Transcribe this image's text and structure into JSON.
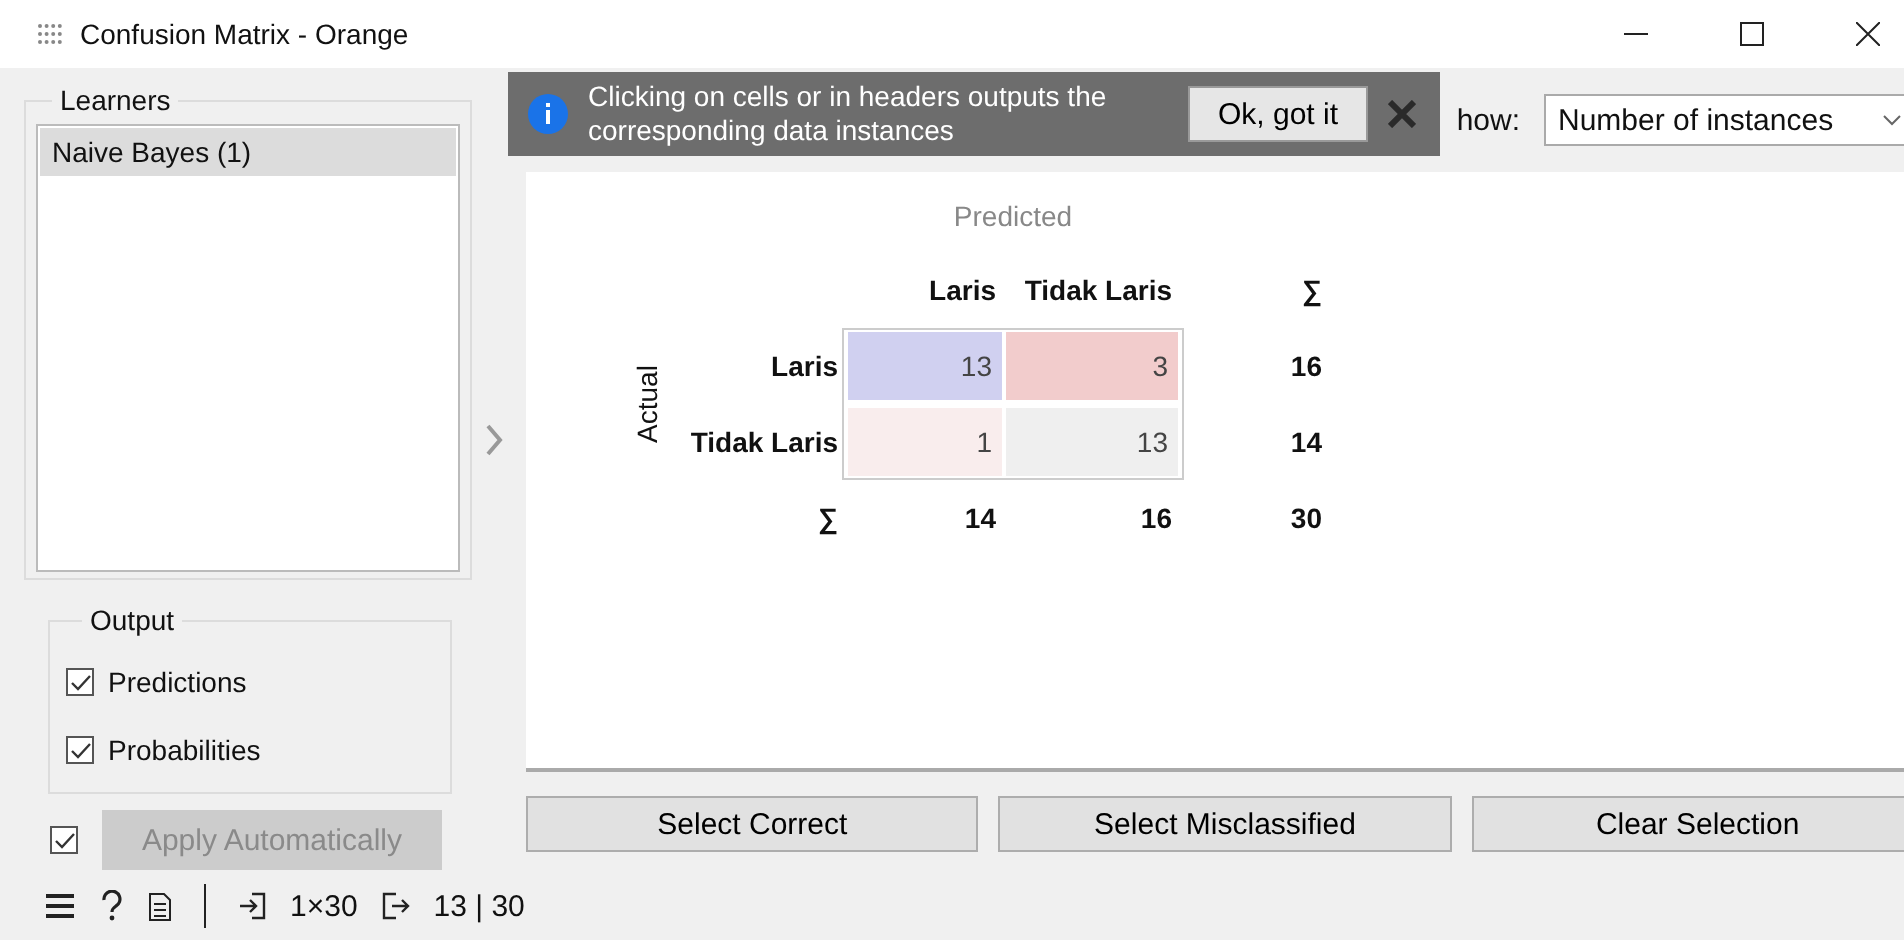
{
  "window": {
    "title": "Confusion Matrix - Orange"
  },
  "learners": {
    "title": "Learners",
    "items": [
      {
        "label": "Naive Bayes (1)",
        "selected": true
      }
    ]
  },
  "output": {
    "title": "Output",
    "options": [
      {
        "label": "Predictions",
        "checked": true
      },
      {
        "label": "Probabilities",
        "checked": true
      }
    ]
  },
  "apply": {
    "checked": true,
    "label": "Apply Automatically",
    "disabled": true
  },
  "notification": {
    "message": "Clicking on cells or in headers outputs the corresponding data instances",
    "button": "Ok, got it"
  },
  "show": {
    "label": "how:",
    "value": "Number of instances"
  },
  "matrix": {
    "predicted_label": "Predicted",
    "actual_label": "Actual",
    "columns": [
      "Laris",
      "Tidak Laris"
    ],
    "sum_header": "∑",
    "rows": [
      {
        "label": "Laris",
        "cells": [
          {
            "value": "13",
            "color": "#d0d0f0"
          },
          {
            "value": "3",
            "color": "#f2cccc"
          }
        ],
        "total": "16"
      },
      {
        "label": "Tidak Laris",
        "cells": [
          {
            "value": "1",
            "color": "#f9eded"
          },
          {
            "value": "13",
            "color": "#efefef"
          }
        ],
        "total": "14"
      }
    ],
    "sum_row_label": "∑",
    "column_totals": [
      "14",
      "16"
    ],
    "grand_total": "30"
  },
  "buttons": [
    "Select Correct",
    "Select Misclassified",
    "Clear Selection"
  ],
  "status_bar": {
    "input": "1×30",
    "output": "13 | 30"
  }
}
